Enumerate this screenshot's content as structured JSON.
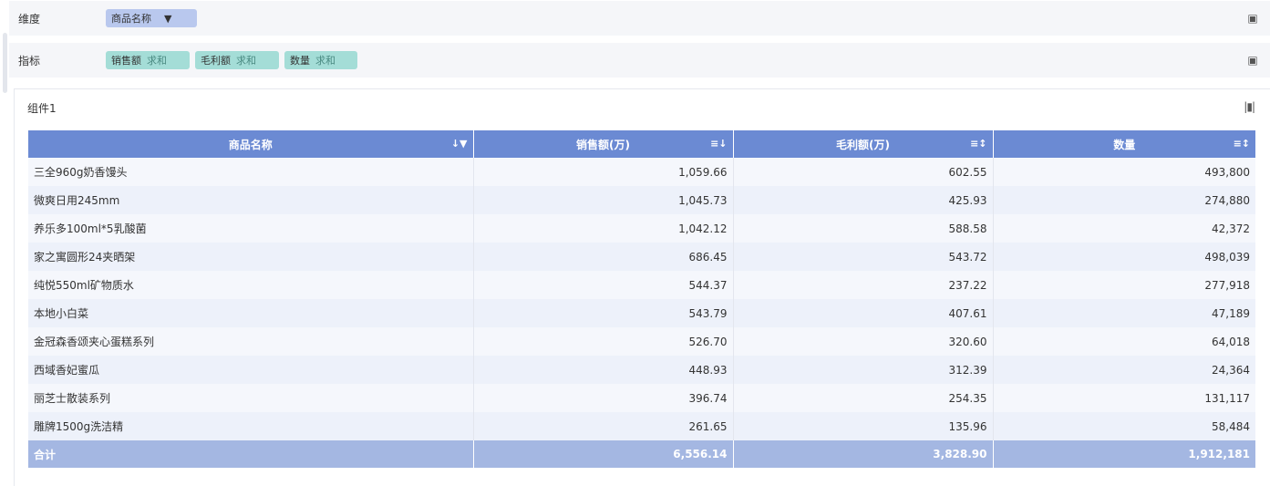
{
  "dimension_row": {
    "label": "维度",
    "pills": [
      {
        "name": "商品名称",
        "icon": "filter-icon"
      }
    ],
    "action_icon": "settings-icon"
  },
  "metric_row": {
    "label": "指标",
    "pills": [
      {
        "name": "销售额",
        "agg": "求和"
      },
      {
        "name": "毛利额",
        "agg": "求和"
      },
      {
        "name": "数量",
        "agg": "求和"
      }
    ],
    "action_icon": "settings-icon"
  },
  "panel": {
    "title": "组件1",
    "toolbar_icon": "column-settings-icon"
  },
  "table": {
    "columns": [
      {
        "label": "商品名称",
        "icon": "sort-filter-icon"
      },
      {
        "label": "销售额(万)",
        "icon": "sort-desc-icon"
      },
      {
        "label": "毛利额(万)",
        "icon": "sort-icon"
      },
      {
        "label": "数量",
        "icon": "sort-icon"
      }
    ],
    "rows": [
      [
        "三全960g奶香馒头",
        "1,059.66",
        "602.55",
        "493,800"
      ],
      [
        "微爽日用245mm",
        "1,045.73",
        "425.93",
        "274,880"
      ],
      [
        "养乐多100ml*5乳酸菌",
        "1,042.12",
        "588.58",
        "42,372"
      ],
      [
        "家之寓圆形24夹晒架",
        "686.45",
        "543.72",
        "498,039"
      ],
      [
        "纯悦550ml矿物质水",
        "544.37",
        "237.22",
        "277,918"
      ],
      [
        "本地小白菜",
        "543.79",
        "407.61",
        "47,189"
      ],
      [
        "金冠森香颂夹心蛋糕系列",
        "526.70",
        "320.60",
        "64,018"
      ],
      [
        "西域香妃蜜瓜",
        "448.93",
        "312.39",
        "24,364"
      ],
      [
        "丽芝士散装系列",
        "396.74",
        "254.35",
        "131,117"
      ],
      [
        "雕牌1500g洗洁精",
        "261.65",
        "135.96",
        "58,484"
      ]
    ],
    "total": [
      "合计",
      "6,556.14",
      "3,828.90",
      "1,912,181"
    ]
  },
  "colors": {
    "header": "#6b8ad3",
    "total_row": "#a4b7e2",
    "dimension_pill": "#b9c8ee",
    "metric_pill": "#a4ddd7"
  }
}
